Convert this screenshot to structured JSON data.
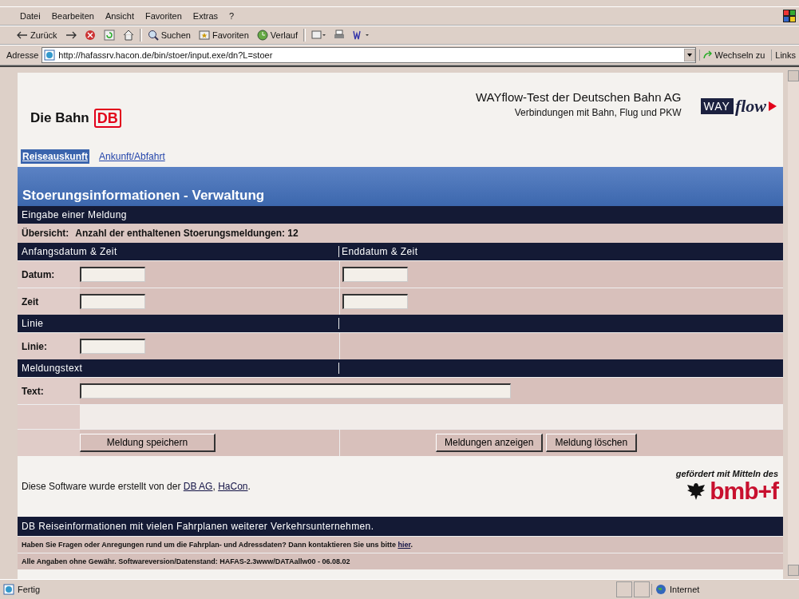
{
  "menu": [
    "Datei",
    "Bearbeiten",
    "Ansicht",
    "Favoriten",
    "Extras",
    "?"
  ],
  "toolbar": [
    {
      "kind": "back",
      "label": "Zurück"
    },
    {
      "kind": "forward"
    },
    {
      "kind": "stop"
    },
    {
      "kind": "refresh"
    },
    {
      "kind": "home"
    },
    {
      "kind": "search",
      "label": "Suchen"
    },
    {
      "kind": "favorites",
      "label": "Favoriten"
    },
    {
      "kind": "history",
      "label": "Verlauf"
    },
    {
      "kind": "mail"
    },
    {
      "kind": "print"
    },
    {
      "kind": "edit"
    }
  ],
  "address": {
    "label": "Adresse",
    "url": "http://hafassrv.hacon.de/bin/stoer/input.exe/dn?L=stoer",
    "go": "Wechseln zu",
    "links": "Links"
  },
  "header": {
    "brand": "Die Bahn",
    "logo": "DB",
    "title": "WAYflow-Test der Deutschen Bahn AG",
    "subtitle": "Verbindungen mit Bahn, Flug und PKW",
    "partner_logo": {
      "left": "WAY",
      "right": "flow"
    }
  },
  "tabs": [
    {
      "label": "Reiseauskunft",
      "selected": true
    },
    {
      "label": "Ankunft/Abfahrt",
      "selected": false
    }
  ],
  "page_title": "Stoerungsinformationen - Verwaltung",
  "heading": "Eingabe einer Meldung",
  "summary": {
    "label": "Übersicht:",
    "text": "Anzahl der enthaltenen Stoerungsmeldungen: 12"
  },
  "rows": [
    {
      "kind": "header",
      "labels": [
        "Anfangsdatum & Zeit",
        "Enddatum & Zeit"
      ]
    },
    {
      "kind": "pair",
      "label": "Datum:"
    },
    {
      "kind": "pair",
      "label": "Zeit"
    },
    {
      "kind": "header",
      "labels": [
        "Linie"
      ]
    },
    {
      "kind": "single",
      "label": "Linie:"
    },
    {
      "kind": "header",
      "labels": [
        "Meldungstext"
      ]
    },
    {
      "kind": "text",
      "label": "Text:"
    },
    {
      "kind": "blank"
    },
    {
      "kind": "buttons",
      "left": [
        "Meldung speichern"
      ],
      "right": [
        "Meldungen anzeigen",
        "Meldung löschen"
      ]
    }
  ],
  "credit": {
    "before": "Diese Software wurde erstellt von der ",
    "links": [
      "DB AG",
      "HaCon"
    ],
    "separator": ", ",
    "after": "."
  },
  "sponsor": {
    "caption": "gefördert mit Mitteln des",
    "logo": "bmb+f"
  },
  "bottom_bar": "DB Reiseinformationen mit vielen Fahrplanen weiterer Verkehrsunternehmen.",
  "contact": {
    "text": "Haben Sie Fragen oder Anregungen rund um die Fahrplan- und Adressdaten? Dann kontaktieren Sie uns bitte ",
    "link": "hier",
    "after": "."
  },
  "version": "Alle Angaben ohne Gewähr. Softwareversion/Datenstand: HAFAS-2.3www/DATAallw00 - 06.08.02",
  "status": {
    "text": "Fertig",
    "zone": "Internet"
  }
}
